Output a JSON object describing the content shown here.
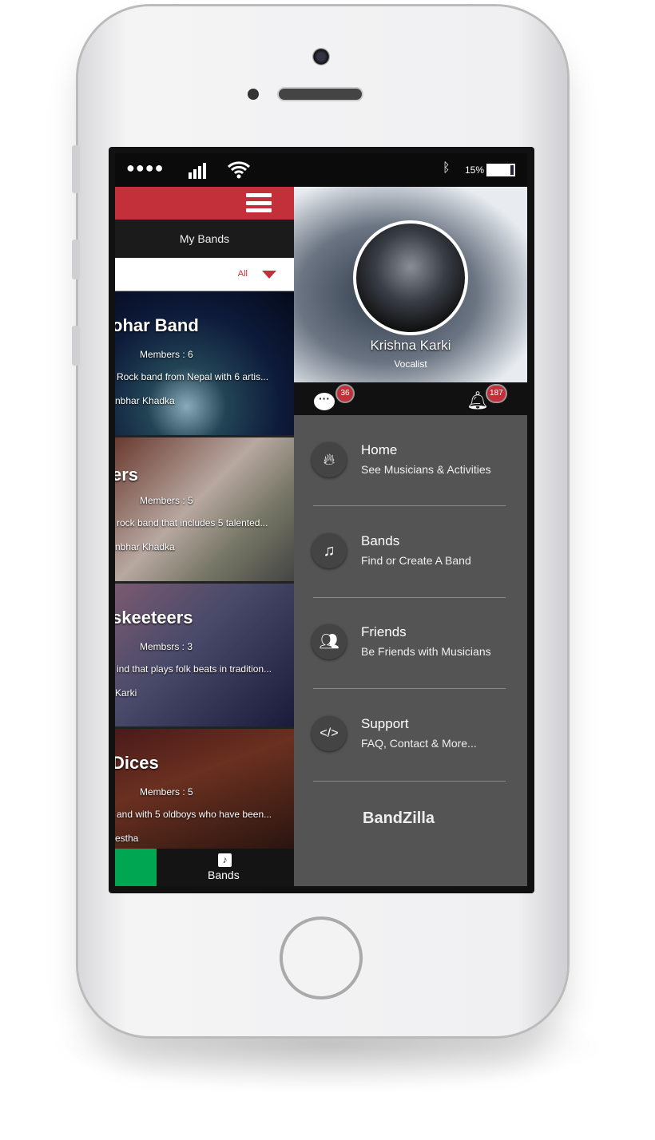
{
  "status_bar": {
    "battery": "15%",
    "battery_level": 0.15,
    "icons": [
      "signal-dots-icon",
      "cell-signal-icon",
      "wifi-icon",
      "bluetooth-icon",
      "battery-icon"
    ]
  },
  "left_panel": {
    "title": "My Bands",
    "filter": {
      "selected": "All"
    },
    "bands": [
      {
        "name": "ohar Band",
        "members": "Members : 6",
        "description": "Rock band from Nepal with 6 artis...",
        "owner": "nbhar Khadka"
      },
      {
        "name": "ers",
        "members": "Members : 5",
        "description": "rock band that includes 5 talented...",
        "owner": "nbhar Khadka"
      },
      {
        "name": "skeeteers",
        "members": "Membsrs : 3",
        "description": "ind that plays folk beats in tradition...",
        "owner": "Karki"
      },
      {
        "name": "Dices",
        "members": "Members : 5",
        "description": "and with 5 oldboys who have been...",
        "owner": "estha"
      }
    ],
    "bottom_nav": {
      "label": "Bands"
    }
  },
  "profile": {
    "name": "Krishna Karki",
    "role": "Vocalist",
    "messages_count": "36",
    "notifications_count": "187"
  },
  "menu": [
    {
      "title": "Home",
      "subtitle": "See Musicians & Activities",
      "icon": "flame-icon"
    },
    {
      "title": "Bands",
      "subtitle": "Find or Create A Band",
      "icon": "guitar-icon"
    },
    {
      "title": "Friends",
      "subtitle": "Be Friends with Musicians",
      "icon": "friends-icon"
    },
    {
      "title": "Support",
      "subtitle": "FAQ, Contact & More...",
      "icon": "code-icon"
    }
  ],
  "logo": "BandZilla",
  "colors": {
    "accent": "#c3303a",
    "green": "#00a651",
    "menu_bg": "#545454"
  }
}
